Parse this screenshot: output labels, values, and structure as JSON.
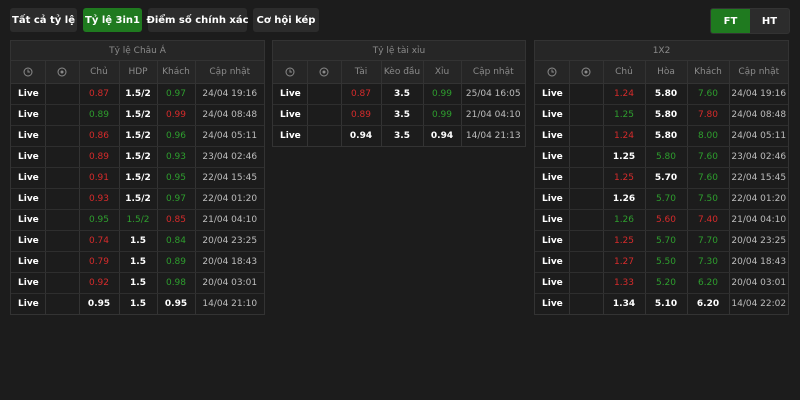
{
  "tabs": [
    {
      "label": "Tất cả tỷ lệ",
      "active": false
    },
    {
      "label": "Tỷ lệ 3in1",
      "active": true
    },
    {
      "label": "Điểm số chính xác",
      "active": false
    },
    {
      "label": "Cơ hội kép",
      "active": false
    }
  ],
  "toggle": {
    "ft": "FT",
    "ht": "HT"
  },
  "colors": {
    "accent": "#1f7a1f",
    "up": "#2e9e2e",
    "down": "#d62b2b"
  },
  "asian": {
    "title": "Tỷ lệ Châu Á",
    "headers": {
      "clock": "clock-icon",
      "ball": "ball-icon",
      "home": "Chủ",
      "hdp": "HDP",
      "away": "Khách",
      "update": "Cập nhật"
    },
    "rows": [
      {
        "status": "Live",
        "home": "0.87",
        "home_c": "red",
        "hdp": "1.5/2",
        "hdp_c": "",
        "away": "0.97",
        "away_c": "green",
        "time": "24/04 19:16"
      },
      {
        "status": "Live",
        "home": "0.89",
        "home_c": "green",
        "hdp": "1.5/2",
        "hdp_c": "",
        "away": "0.99",
        "away_c": "red",
        "time": "24/04 08:48"
      },
      {
        "status": "Live",
        "home": "0.86",
        "home_c": "red",
        "hdp": "1.5/2",
        "hdp_c": "",
        "away": "0.96",
        "away_c": "green",
        "time": "24/04 05:11"
      },
      {
        "status": "Live",
        "home": "0.89",
        "home_c": "red",
        "hdp": "1.5/2",
        "hdp_c": "",
        "away": "0.93",
        "away_c": "green",
        "time": "23/04 02:46"
      },
      {
        "status": "Live",
        "home": "0.91",
        "home_c": "red",
        "hdp": "1.5/2",
        "hdp_c": "",
        "away": "0.95",
        "away_c": "green",
        "time": "22/04 15:45"
      },
      {
        "status": "Live",
        "home": "0.93",
        "home_c": "red",
        "hdp": "1.5/2",
        "hdp_c": "",
        "away": "0.97",
        "away_c": "green",
        "time": "22/04 01:20"
      },
      {
        "status": "Live",
        "home": "0.95",
        "home_c": "green",
        "hdp": "1.5/2",
        "hdp_c": "green",
        "away": "0.85",
        "away_c": "red",
        "time": "21/04 04:10"
      },
      {
        "status": "Live",
        "home": "0.74",
        "home_c": "red",
        "hdp": "1.5",
        "hdp_c": "",
        "away": "0.84",
        "away_c": "green",
        "time": "20/04 23:25"
      },
      {
        "status": "Live",
        "home": "0.79",
        "home_c": "red",
        "hdp": "1.5",
        "hdp_c": "",
        "away": "0.89",
        "away_c": "green",
        "time": "20/04 18:43"
      },
      {
        "status": "Live",
        "home": "0.92",
        "home_c": "red",
        "hdp": "1.5",
        "hdp_c": "",
        "away": "0.98",
        "away_c": "green",
        "time": "20/04 03:01"
      },
      {
        "status": "Live",
        "home": "0.95",
        "home_c": "",
        "hdp": "1.5",
        "hdp_c": "",
        "away": "0.95",
        "away_c": "",
        "time": "14/04 21:10"
      }
    ]
  },
  "overunder": {
    "title": "Tỷ lệ tài xỉu",
    "headers": {
      "clock": "clock-icon",
      "ball": "ball-icon",
      "over": "Tài",
      "line": "Kèo đầu",
      "under": "Xỉu",
      "update": "Cập nhật"
    },
    "rows": [
      {
        "status": "Live",
        "over": "0.87",
        "over_c": "red",
        "line": "3.5",
        "under": "0.99",
        "under_c": "green",
        "time": "25/04 16:05"
      },
      {
        "status": "Live",
        "over": "0.89",
        "over_c": "red",
        "line": "3.5",
        "under": "0.99",
        "under_c": "green",
        "time": "21/04 04:10"
      },
      {
        "status": "Live",
        "over": "0.94",
        "over_c": "",
        "line": "3.5",
        "under": "0.94",
        "under_c": "",
        "time": "14/04 21:13"
      }
    ]
  },
  "x12": {
    "title": "1X2",
    "headers": {
      "clock": "clock-icon",
      "ball": "ball-icon",
      "home": "Chủ",
      "draw": "Hòa",
      "away": "Khách",
      "update": "Cập nhật"
    },
    "rows": [
      {
        "status": "Live",
        "home": "1.24",
        "home_c": "red",
        "draw": "5.80",
        "draw_c": "",
        "away": "7.60",
        "away_c": "green",
        "time": "24/04 19:16"
      },
      {
        "status": "Live",
        "home": "1.25",
        "home_c": "green",
        "draw": "5.80",
        "draw_c": "",
        "away": "7.80",
        "away_c": "red",
        "time": "24/04 08:48"
      },
      {
        "status": "Live",
        "home": "1.24",
        "home_c": "red",
        "draw": "5.80",
        "draw_c": "",
        "away": "8.00",
        "away_c": "green",
        "time": "24/04 05:11"
      },
      {
        "status": "Live",
        "home": "1.25",
        "home_c": "",
        "draw": "5.80",
        "draw_c": "green",
        "away": "7.60",
        "away_c": "green",
        "time": "23/04 02:46"
      },
      {
        "status": "Live",
        "home": "1.25",
        "home_c": "red",
        "draw": "5.70",
        "draw_c": "",
        "away": "7.60",
        "away_c": "green",
        "time": "22/04 15:45"
      },
      {
        "status": "Live",
        "home": "1.26",
        "home_c": "",
        "draw": "5.70",
        "draw_c": "green",
        "away": "7.50",
        "away_c": "green",
        "time": "22/04 01:20"
      },
      {
        "status": "Live",
        "home": "1.26",
        "home_c": "green",
        "draw": "5.60",
        "draw_c": "red",
        "away": "7.40",
        "away_c": "red",
        "time": "21/04 04:10"
      },
      {
        "status": "Live",
        "home": "1.25",
        "home_c": "red",
        "draw": "5.70",
        "draw_c": "green",
        "away": "7.70",
        "away_c": "green",
        "time": "20/04 23:25"
      },
      {
        "status": "Live",
        "home": "1.27",
        "home_c": "red",
        "draw": "5.50",
        "draw_c": "green",
        "away": "7.30",
        "away_c": "green",
        "time": "20/04 18:43"
      },
      {
        "status": "Live",
        "home": "1.33",
        "home_c": "red",
        "draw": "5.20",
        "draw_c": "green",
        "away": "6.20",
        "away_c": "green",
        "time": "20/04 03:01"
      },
      {
        "status": "Live",
        "home": "1.34",
        "home_c": "",
        "draw": "5.10",
        "draw_c": "",
        "away": "6.20",
        "away_c": "",
        "time": "14/04 22:02"
      }
    ]
  }
}
